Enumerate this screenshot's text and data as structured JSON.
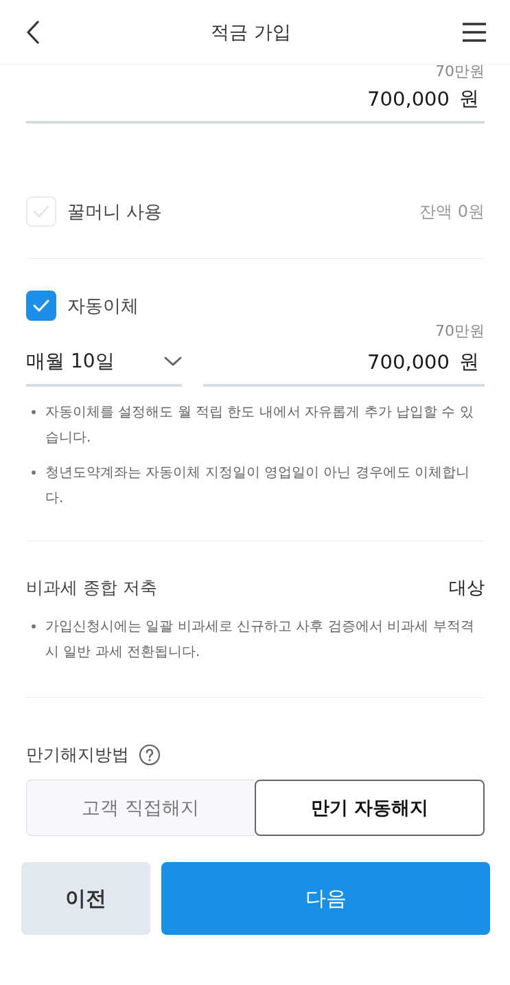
{
  "header": {
    "title": "적금 가입"
  },
  "monthly_amount": {
    "hint": "70만원",
    "value": "700,000",
    "unit": "원"
  },
  "honey_money": {
    "label": "꿀머니 사용",
    "checked": false,
    "balance": "잔액 0원"
  },
  "auto_transfer": {
    "label": "자동이체",
    "checked": true,
    "hint": "70만원",
    "day": "매월 10일",
    "value": "700,000",
    "unit": "원",
    "notes": [
      "자동이체를 설정해도 월 적립 한도 내에서 자유롭게 추가 납입할 수 있습니다.",
      "청년도약계좌는 자동이체 지정일이 영업일이 아닌 경우에도 이체합니다."
    ]
  },
  "tax_free": {
    "label": "비과세 종합 저축",
    "value": "대상",
    "notes": [
      "가입신청시에는 일괄 비과세로 신규하고 사후 검증에서 비과세 부적격 시 일반 과세 전환됩니다."
    ]
  },
  "maturity": {
    "label": "만기해지방법",
    "options": [
      {
        "label": "고객 직접해지",
        "selected": false
      },
      {
        "label": "만기 자동해지",
        "selected": true
      }
    ]
  },
  "buttons": {
    "prev": "이전",
    "next": "다음"
  }
}
